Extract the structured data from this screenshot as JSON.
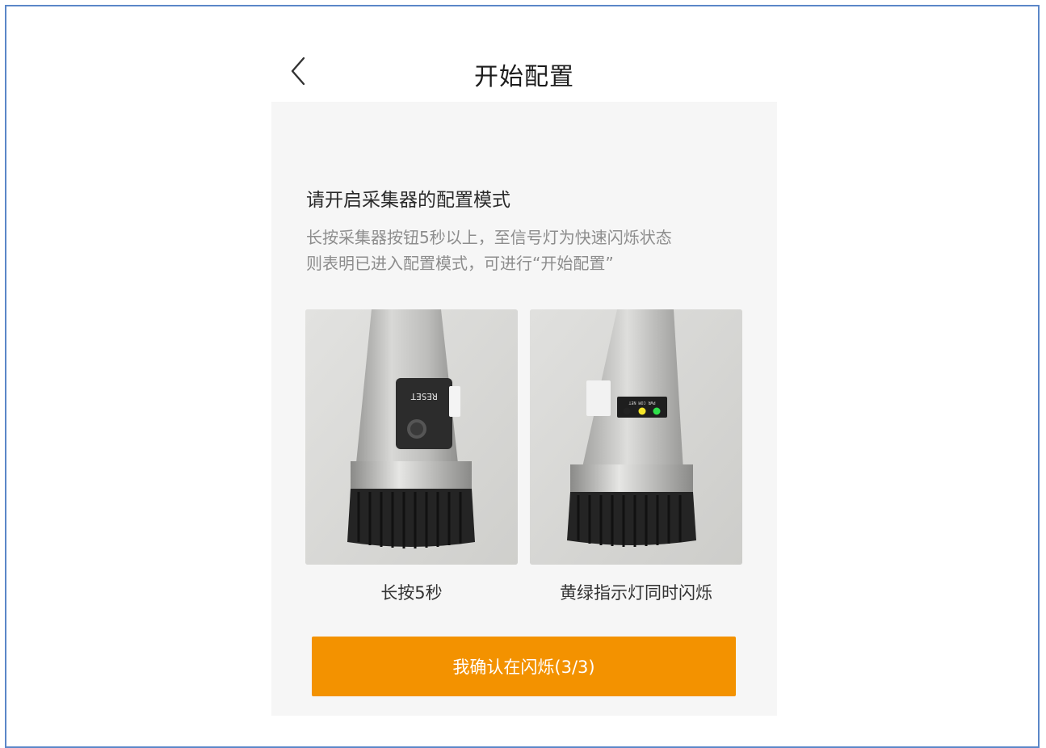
{
  "nav": {
    "title": "开始配置",
    "back_icon": "chevron-left-icon"
  },
  "content": {
    "heading": "请开启采集器的配置模式",
    "description_line1": "长按采集器按钮5秒以上，至信号灯为快速闪烁状态",
    "description_line2": "则表明已进入配置模式，可进行“开始配置”"
  },
  "photos": [
    {
      "caption": "长按5秒",
      "device_label": "RESET"
    },
    {
      "caption": "黄绿指示灯同时闪烁",
      "device_label": "PWR COM NET",
      "led_colors": [
        "#222222",
        "#f5e62a",
        "#2ee04a"
      ]
    }
  ],
  "button": {
    "label": "我确认在闪烁(3/3)"
  },
  "colors": {
    "accent": "#f39200",
    "panel_bg": "#f6f6f6",
    "frame_border": "#5b87c8"
  }
}
